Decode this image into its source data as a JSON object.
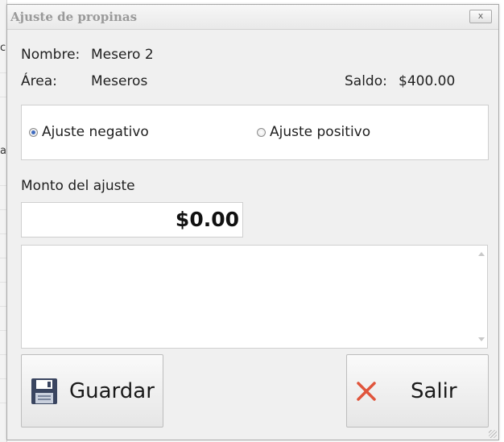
{
  "dialog": {
    "title": "Ajuste de propinas",
    "close_label": "x"
  },
  "info": {
    "nombre_label": "Nombre:",
    "nombre_value": "Mesero 2",
    "area_label": "Área:",
    "area_value": "Meseros",
    "saldo_label": "Saldo:",
    "saldo_value": "$400.00"
  },
  "adjustment_type": {
    "negative_label": "Ajuste negativo",
    "positive_label": "Ajuste positivo",
    "selected": "negative"
  },
  "amount": {
    "label": "Monto del ajuste",
    "value": "$0.00"
  },
  "memo": {
    "value": ""
  },
  "buttons": {
    "save_label": "Guardar",
    "save_icon": "floppy-disk-icon",
    "exit_label": "Salir",
    "exit_icon": "close-x-icon"
  },
  "colors": {
    "radio_selected": "#3f6bbf",
    "exit_icon": "#e0553c",
    "save_icon": "#3a4560"
  }
}
